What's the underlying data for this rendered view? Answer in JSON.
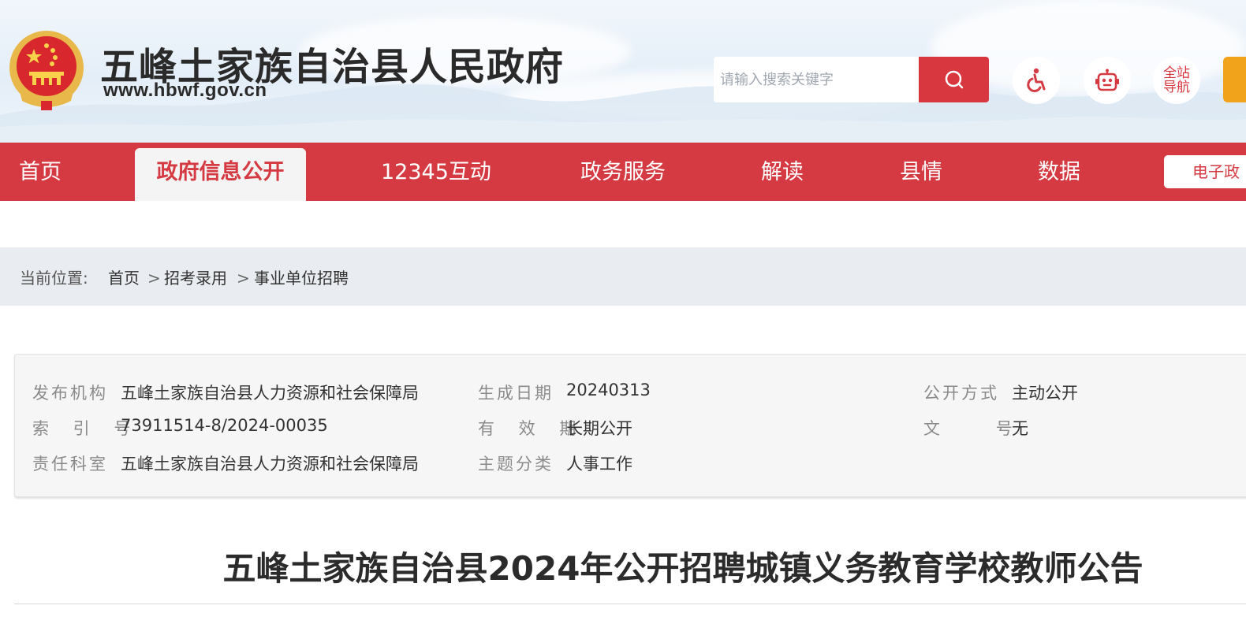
{
  "header": {
    "site_title": "五峰土家族自治县人民政府",
    "site_url": "www.hbwf.gov.cn",
    "search_placeholder": "请输入搜索关键字",
    "nav_guide_label": "全站导航",
    "nav_guide_line1": "全站",
    "nav_guide_line2": "导航",
    "emblem_icon": "national-emblem-icon",
    "accent_color": "#d53a42"
  },
  "nav": {
    "items": [
      {
        "label": "首页"
      },
      {
        "label": "政府信息公开",
        "active": true
      },
      {
        "label": "12345互动"
      },
      {
        "label": "政务服务"
      },
      {
        "label": "解读"
      },
      {
        "label": "县情"
      },
      {
        "label": "数据"
      }
    ],
    "egov_label": "电子政"
  },
  "breadcrumb": {
    "prefix": "当前位置:",
    "items": [
      "首页",
      "招考录用",
      "事业单位招聘"
    ],
    "separator": ">"
  },
  "meta": {
    "publisher_label": "发布机构",
    "publisher": "五峰土家族自治县人力资源和社会保障局",
    "index_label": "索 引 号",
    "index": "73911514-8/2024-00035",
    "dept_label": "责任科室",
    "dept": "五峰土家族自治县人力资源和社会保障局",
    "date_label": "生成日期",
    "date": "20240313",
    "validity_label": "有 效 期",
    "validity": "长期公开",
    "topic_label": "主题分类",
    "topic": "人事工作",
    "disclosure_label": "公开方式",
    "disclosure": "主动公开",
    "doc_no_label": "文       号",
    "doc_no": "无"
  },
  "article": {
    "title": "五峰土家族自治县2024年公开招聘城镇义务教育学校教师公告"
  }
}
